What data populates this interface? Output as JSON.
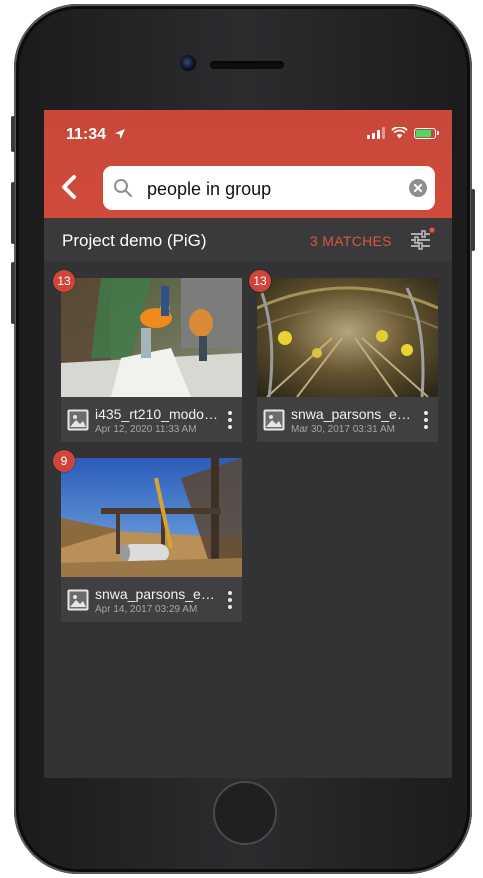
{
  "status_bar": {
    "time": "11:34"
  },
  "search": {
    "query": "people in group"
  },
  "project": {
    "title": "Project demo (PiG)",
    "matches_label": "3 MATCHES"
  },
  "items": [
    {
      "badge": "13",
      "name": "i435_rt210_modot.…",
      "date": "Apr 12, 2020 11:33 AM"
    },
    {
      "badge": "13",
      "name": "snwa_parsons_enr…",
      "date": "Mar 30, 2017 03:31 AM"
    },
    {
      "badge": "9",
      "name": "snwa_parsons_enr…",
      "date": "Apr 14, 2017 03:29 AM"
    }
  ],
  "colors": {
    "brand_red": "#cf4b3b",
    "matches_text": "#d9553f",
    "badge": "#d0453a",
    "background": "#333335"
  },
  "icons": {
    "back": "chevron-left-icon",
    "search": "magnifier-icon",
    "clear": "x-circle-icon",
    "filter": "sliders-icon",
    "file": "image-icon",
    "more": "vertical-dots-icon"
  }
}
